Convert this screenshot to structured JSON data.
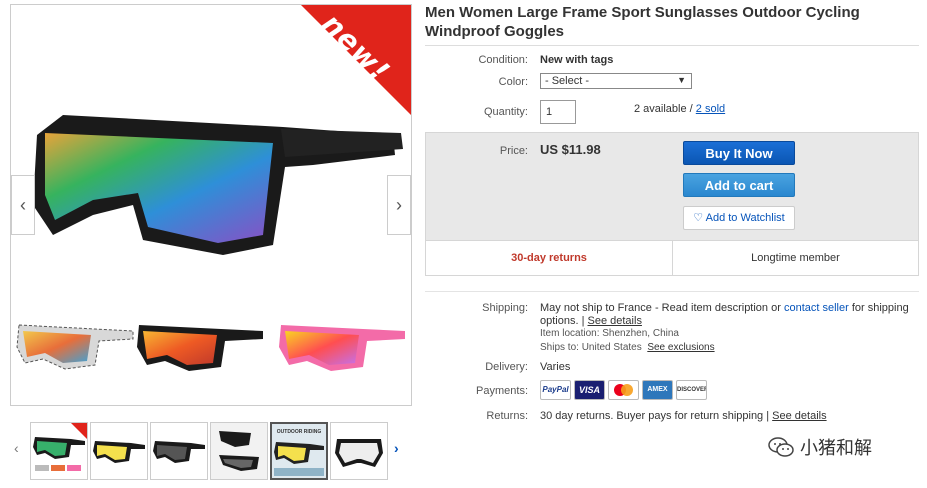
{
  "gallery": {
    "badge_text": "new!",
    "prev_arrow": "‹",
    "next_arrow": "›",
    "thumb_prev": "‹",
    "thumb_next": "›",
    "thumb_caption": "OUTDOOR RIDING"
  },
  "product": {
    "title": "Men Women Large Frame Sport Sunglasses Outdoor Cycling Windproof Goggles"
  },
  "fields": {
    "condition_label": "Condition:",
    "condition_value": "New with tags",
    "color_label": "Color:",
    "color_selected": "- Select -",
    "quantity_label": "Quantity:",
    "quantity_value": "1",
    "available_text": "2 available /",
    "sold_link": "2 sold"
  },
  "price": {
    "label": "Price:",
    "value": "US $11.98",
    "buy_now": "Buy It Now",
    "add_to_cart": "Add to cart",
    "watchlist": "Add to Watchlist"
  },
  "assurance": {
    "returns": "30-day returns",
    "member": "Longtime member"
  },
  "shipping": {
    "label": "Shipping:",
    "line1_prefix": "May not ship to France - Read item description or ",
    "contact_link": "contact seller",
    "line1_suffix": " for shipping",
    "line2": "options. |",
    "see_details": "See details",
    "location_label": "Item location:",
    "location_value": "Shenzhen, China",
    "ships_label": "Ships to:",
    "ships_value": "United States",
    "exclusions_link": "See exclusions"
  },
  "delivery": {
    "label": "Delivery:",
    "value": "Varies"
  },
  "payments": {
    "label": "Payments:",
    "methods": [
      "PayPal",
      "VISA",
      "MasterCard",
      "AMEX",
      "DISCOVER"
    ]
  },
  "returns": {
    "label": "Returns:",
    "value": "30 day returns. Buyer pays for return shipping |",
    "link": "See details"
  },
  "watermark": {
    "text": "小猪和解"
  },
  "colors": {
    "accent_blue": "#0654ba",
    "buy_button": "#0b56b3",
    "cart_button": "#2a87cf",
    "badge_red": "#e0241b",
    "returns_red": "#c0392b"
  }
}
